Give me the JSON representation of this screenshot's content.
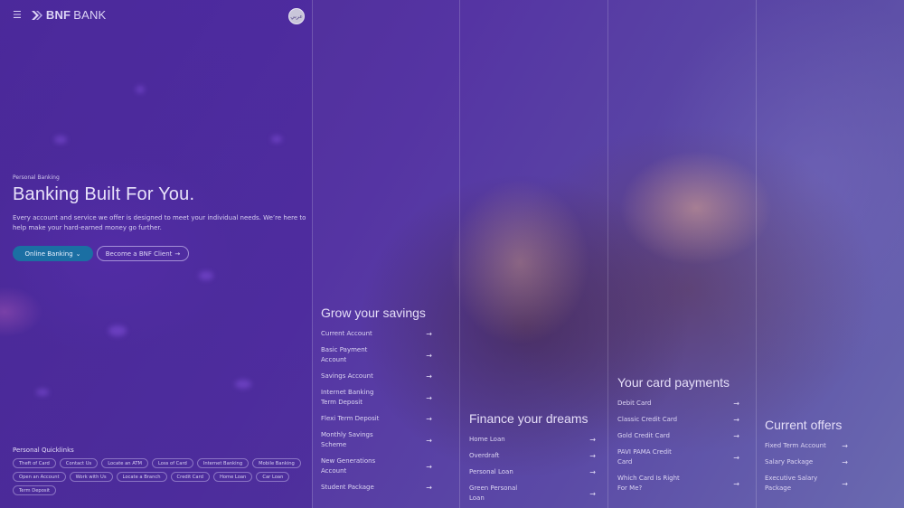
{
  "brand": {
    "menu_icon": "hamburger-icon",
    "logo_mark_icon": "bnf-chevron-icon",
    "name_bold": "BNF",
    "name_light": "BANK",
    "language_badge": "عربي"
  },
  "hero": {
    "kicker": "Personal Banking",
    "title": "Banking Built For You.",
    "description": "Every account and service we offer is designed to meet your individual needs. We’re here to help make your hard-earned money go further.",
    "primary_button": "Online Banking",
    "secondary_button": "Become a BNF Client"
  },
  "quicklinks": {
    "title": "Personal Quicklinks",
    "items": [
      "Theft of Card",
      "Contact Us",
      "Locate an ATM",
      "Loss of Card",
      "Internet Banking",
      "Mobile Banking",
      "Open an Account",
      "Work with Us",
      "Locate a Branch",
      "Credit Card",
      "Home Loan",
      "Car Loan",
      "Term Deposit"
    ]
  },
  "columns": [
    {
      "title": "Grow your savings",
      "items": [
        "Current Account",
        "Basic Payment Account",
        "Savings Account",
        "Internet Banking Term Deposit",
        "Flexi Term Deposit",
        "Monthly Savings Scheme",
        "New Generations Account",
        "Student Package"
      ]
    },
    {
      "title": "Finance your dreams",
      "items": [
        "Home Loan",
        "Overdraft",
        "Personal Loan",
        "Green Personal Loan"
      ]
    },
    {
      "title": "Your card payments",
      "items": [
        "Debit Card",
        "Classic Credit Card",
        "Gold Credit Card",
        "PAVI PAMA Credit Card",
        "Which Card Is Right For Me?"
      ]
    },
    {
      "title": "Current offers",
      "items": [
        "Fixed Term Account",
        "Salary Package",
        "Executive Salary Package"
      ]
    }
  ],
  "colors": {
    "overlay": "#4a2e8e",
    "primary_button": "#1b6fa3"
  }
}
